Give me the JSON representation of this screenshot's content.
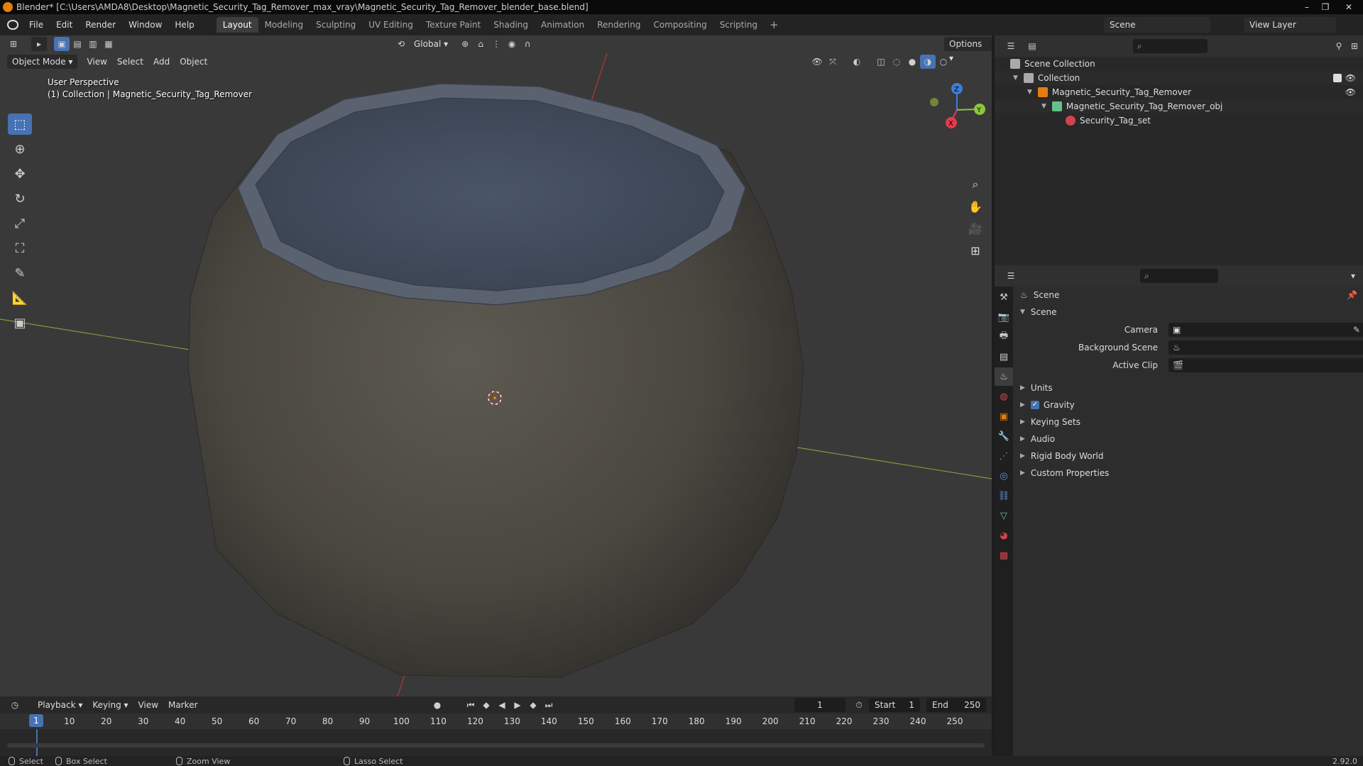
{
  "window": {
    "title": "Blender* [C:\\Users\\AMDA8\\Desktop\\Magnetic_Security_Tag_Remover_max_vray\\Magnetic_Security_Tag_Remover_blender_base.blend]",
    "controls": [
      "–",
      "❐",
      "✕"
    ]
  },
  "menu": [
    "File",
    "Edit",
    "Render",
    "Window",
    "Help"
  ],
  "workspaces": [
    "Layout",
    "Modeling",
    "Sculpting",
    "UV Editing",
    "Texture Paint",
    "Shading",
    "Animation",
    "Rendering",
    "Compositing",
    "Scripting"
  ],
  "workspace_add": "+",
  "scene_selector": "Scene",
  "view_layer_selector": "View Layer",
  "viewport": {
    "mode": "Object Mode",
    "header_menu": [
      "View",
      "Select",
      "Add",
      "Object"
    ],
    "transform_orientation": "Global",
    "options_label": "Options",
    "perspective_label": "User Perspective",
    "collection_label": "(1) Collection | Magnetic_Security_Tag_Remover",
    "gizmo_axes": {
      "x": "X",
      "y": "Y",
      "z": "Z"
    }
  },
  "outliner": {
    "rows": [
      {
        "label": "Scene Collection",
        "indent": 0
      },
      {
        "label": "Collection",
        "indent": 1
      },
      {
        "label": "Magnetic_Security_Tag_Remover",
        "indent": 2
      },
      {
        "label": "Magnetic_Security_Tag_Remover_obj",
        "indent": 3
      },
      {
        "label": "Security_Tag_set",
        "indent": 4
      }
    ]
  },
  "properties": {
    "context": "Scene",
    "panel_title": "Scene",
    "fields": [
      {
        "label": "Camera"
      },
      {
        "label": "Background Scene"
      },
      {
        "label": "Active Clip"
      }
    ],
    "panels": [
      "Units",
      "Gravity",
      "Keying Sets",
      "Audio",
      "Rigid Body World",
      "Custom Properties"
    ],
    "gravity_enabled": true
  },
  "timeline": {
    "menu": [
      "Playback",
      "Keying",
      "View",
      "Marker"
    ],
    "current_frame": "1",
    "start_label": "Start",
    "start_value": "1",
    "end_label": "End",
    "end_value": "250",
    "ticks": [
      "1",
      "10",
      "20",
      "30",
      "40",
      "50",
      "60",
      "70",
      "80",
      "90",
      "100",
      "110",
      "120",
      "130",
      "140",
      "150",
      "160",
      "170",
      "180",
      "190",
      "200",
      "210",
      "220",
      "230",
      "240",
      "250"
    ]
  },
  "statusbar": {
    "select": "Select",
    "box_select": "Box Select",
    "zoom_view": "Zoom View",
    "lasso_select": "Lasso Select",
    "version": "2.92.0"
  },
  "colors": {
    "accent": "#4772b3",
    "x_axis": "#e43c4c",
    "y_axis": "#8cc63f",
    "z_axis": "#3f7cd8",
    "object_orange": "#e87d0d"
  }
}
